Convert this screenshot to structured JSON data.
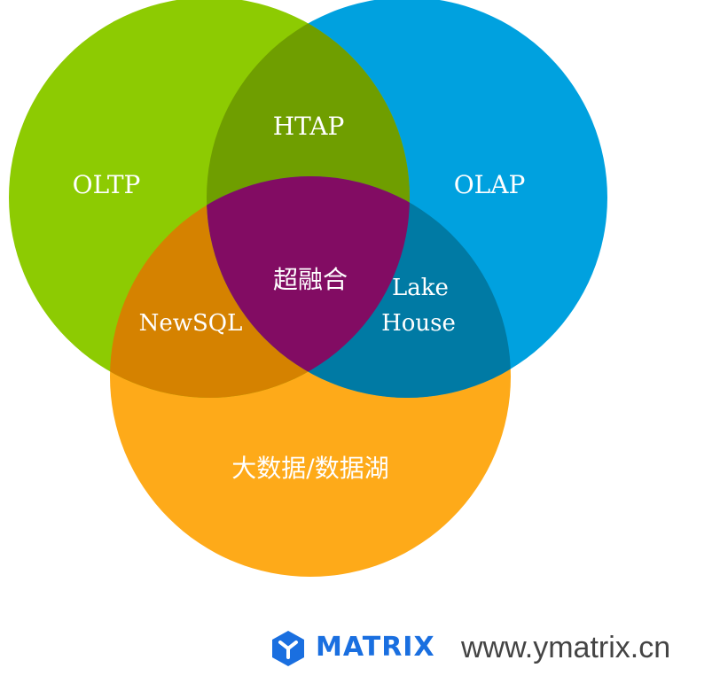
{
  "diagram": {
    "circles": [
      {
        "name": "OLTP",
        "color": "#8dcb02"
      },
      {
        "name": "OLAP",
        "color": "#00a1df"
      },
      {
        "name": "大数据/数据湖",
        "color": "#feaa19"
      }
    ],
    "overlaps": {
      "oltp_olap": {
        "label": "HTAP",
        "color": "#6f9e00"
      },
      "oltp_bigdata": {
        "label": "NewSQL",
        "color": "#d58200"
      },
      "olap_bigdata": {
        "label_line1": "Lake",
        "label_line2": "House",
        "color": "#007aa4"
      },
      "all_three": {
        "label": "超融合",
        "color": "#820c63"
      }
    }
  },
  "footer": {
    "brand": "MATRIX",
    "brand_color": "#1a6fe0",
    "url": "www.ymatrix.cn"
  }
}
